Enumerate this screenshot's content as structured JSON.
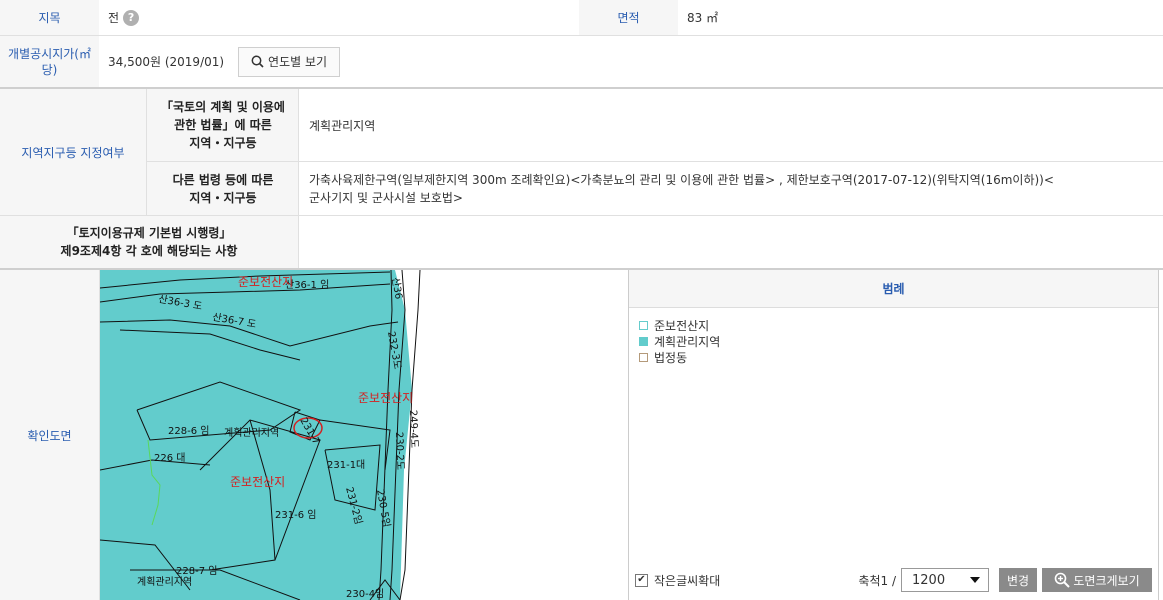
{
  "row1": {
    "label_jimok": "지목",
    "value_jimok": "전",
    "label_area": "면적",
    "value_area": "83 ㎡"
  },
  "row2": {
    "label_price_line1": "개별공시지가(㎡",
    "label_price_line2": "당)",
    "value_price": "34,500원 (2019/01)",
    "yearly_button": "연도별 보기"
  },
  "zone": {
    "title": "지역지구등 지정여부",
    "national_label_lines": [
      "「국토의 계획 및 이용에",
      "관한 법률」에 따른",
      "지역・지구등"
    ],
    "national_value": "계획관리지역",
    "other_label_lines": [
      "다른 법령 등에 따른",
      "지역・지구등"
    ],
    "other_value_line1": "가축사육제한구역(일부제한지역 300m 조례확인요)<가축분뇨의 관리 및 이용에 관한 법률> , 제한보호구역(2017-07-12)(위탁지역(16m이하))<",
    "other_value_line2": "군사기지 및 군사시설 보호법>"
  },
  "decree": {
    "label_line1": "「토지이용규제 기본법 시행령」",
    "label_line2": "제9조제4항 각 호에 해당되는 사항",
    "value": ""
  },
  "map_section": {
    "label": "확인도면",
    "map_labels": {
      "zone_top": "준보전산지",
      "parcel_36_1": "산36-1 임",
      "parcel_36_3": "산36-3 도",
      "parcel_36_7": "산36-7 도",
      "parcel_232": "232-3도",
      "zone_right": "준보전산지",
      "parcel_249": "249-4도",
      "parcel_230_2": "230-2도",
      "parcel_228_6": "228-6 임",
      "label_plan1": "계획관리지역",
      "parcel_231_7": "231-7",
      "parcel_226": "226 대",
      "parcel_231_1": "231-1대",
      "zone_mid": "준보전산지",
      "parcel_231_2": "231-2임",
      "parcel_230_5": "230-5임",
      "parcel_231_6": "231-6 임",
      "parcel_228_7": "228-7 임",
      "label_plan2": "계획관리지역",
      "parcel_230_4": "230-4임",
      "parcel_small": "산36"
    },
    "legend_title": "범례",
    "legend_items": [
      {
        "label": "준보전산지",
        "color": "#ffffff"
      },
      {
        "label": "계획관리지역",
        "color": "#62cccc"
      },
      {
        "label": "법정동",
        "color": "#ffffff"
      }
    ],
    "small_text_label": "작은글씨확대",
    "small_text_checked": true,
    "scale_label": "축척1 /",
    "scale_value": "1200",
    "change_button": "변경",
    "enlarge_button": "도면크게보기"
  },
  "colors": {
    "accent": "#2a5db0",
    "zone_fill": "#62cccc",
    "map_red": "#d42020"
  }
}
